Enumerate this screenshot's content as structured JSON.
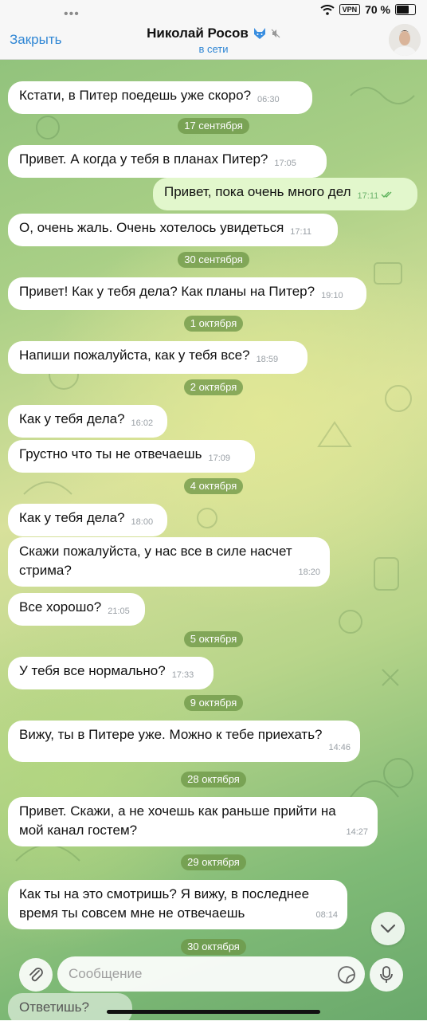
{
  "status_bar": {
    "vpn": "VPN",
    "battery": "70 %"
  },
  "header": {
    "close_label": "Закрыть",
    "title": "Николай Росов",
    "status": "в сети"
  },
  "messages": [
    {
      "type": "in",
      "text": "Кстати, в Питер поедешь уже скоро?",
      "time": "06:30"
    },
    {
      "type": "date",
      "text": "17 сентября"
    },
    {
      "type": "in",
      "text": "Привет. А когда у тебя в планах Питер?",
      "time": "17:05"
    },
    {
      "type": "out",
      "text": "Привет, пока очень много дел",
      "time": "17:11"
    },
    {
      "type": "in",
      "text": "О, очень жаль. Очень хотелось увидеться",
      "time": "17:11"
    },
    {
      "type": "date",
      "text": "30 сентября"
    },
    {
      "type": "in",
      "text": "Привет! Как у тебя дела? Как планы на Питер?",
      "time": "19:10"
    },
    {
      "type": "date",
      "text": "1 октября"
    },
    {
      "type": "in",
      "text": "Напиши пожалуйста, как у тебя все?",
      "time": "18:59"
    },
    {
      "type": "date",
      "text": "2 октября"
    },
    {
      "type": "in",
      "text": "Как у тебя дела?",
      "time": "16:02"
    },
    {
      "type": "in",
      "text": "Грустно что ты не отвечаешь",
      "time": "17:09"
    },
    {
      "type": "date",
      "text": "4 октября"
    },
    {
      "type": "in",
      "text": "Как у тебя дела?",
      "time": "18:00"
    },
    {
      "type": "in",
      "text": "Скажи пожалуйста, у нас все в силе насчет\nстрима?",
      "time": "18:20"
    },
    {
      "type": "in",
      "text": "Все хорошо?",
      "time": "21:05"
    },
    {
      "type": "date",
      "text": "5 октября"
    },
    {
      "type": "in",
      "text": "У тебя все нормально?",
      "time": "17:33"
    },
    {
      "type": "date",
      "text": "9 октября"
    },
    {
      "type": "in",
      "text": "Вижу, ты в Питере уже. Можно к тебе приехать?",
      "time": "14:46"
    },
    {
      "type": "date",
      "text": "28 октября"
    },
    {
      "type": "in",
      "text": "Привет. Скажи, а не хочешь как раньше прийти на\nмой канал гостем?",
      "time": "14:27"
    },
    {
      "type": "date",
      "text": "29 октября"
    },
    {
      "type": "in",
      "text": "Как ты на это смотришь? Я вижу, в последнее\nвремя ты совсем мне не отвечаешь",
      "time": "08:14"
    },
    {
      "type": "date",
      "text": "30 октября"
    }
  ],
  "partial_message": "Ответишь?",
  "composer": {
    "placeholder": "Сообщение"
  },
  "colors": {
    "accent": "#2f86d4",
    "outgoing_bubble": "#e2f7cc",
    "date_pill": "#6c9646"
  }
}
